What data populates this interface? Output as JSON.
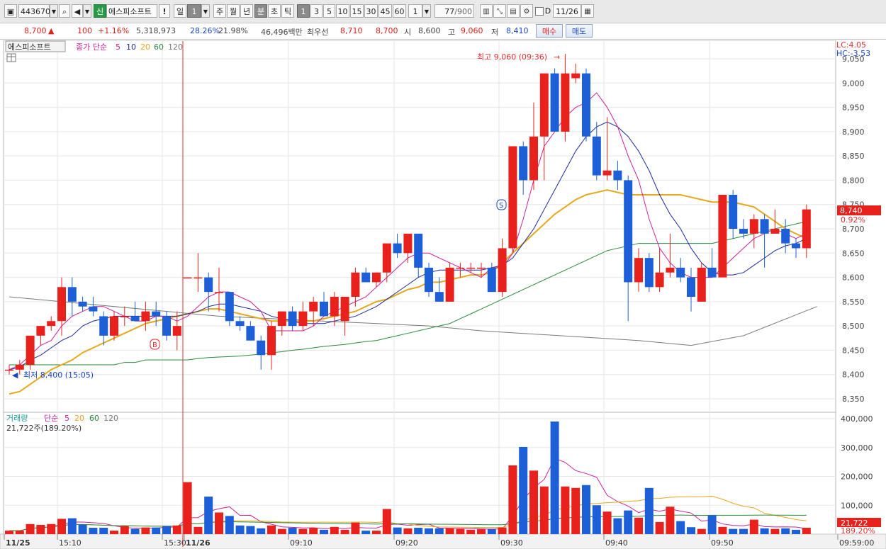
{
  "toolbar": {
    "code": "443670",
    "badge": "신",
    "name": "에스피소프트",
    "warn": "!",
    "period_day": "일",
    "period_num": "1",
    "p_week": "주",
    "p_month": "월",
    "p_year": "년",
    "p_min": "분",
    "p_sec": "초",
    "p_tick": "틱",
    "intervals": [
      "1",
      "3",
      "5",
      "10",
      "15",
      "30",
      "45",
      "60"
    ],
    "interval_value": "1",
    "count": "77",
    "count_total": "/900",
    "date_box_label": "D",
    "date": "11/26"
  },
  "quote": {
    "price": "8,700",
    "arrow": "▲",
    "change": "100",
    "change_pct": "+1.16%",
    "volume": "5,318,973",
    "vol_ratio": "28.26%",
    "turnover": "21.98%",
    "amount": "46,496백만",
    "best_label": "최우선",
    "ask": "8,710",
    "bid": "8,700",
    "open_label": "시",
    "open": "8,600",
    "high_label": "고",
    "high": "9,060",
    "low_label": "저",
    "low": "8,410",
    "buy": "매수",
    "sell": "매도"
  },
  "legend": {
    "name": "에스피소프트",
    "series": "종가 단순",
    "ma5": "5",
    "ma10": "10",
    "ma20": "20",
    "ma60": "60",
    "ma120": "120"
  },
  "annotations": {
    "high": "최고 9,060 (09:36)",
    "low": "최저 8,400 (15:05)",
    "lc": "LC:4.05",
    "hc": "HC:-3.53",
    "last_price": "8,740",
    "last_pct": "0.92%",
    "buy_mark": "B",
    "sell_mark": "S"
  },
  "volume_legend": {
    "name": "거래량",
    "series": "단순",
    "ma5": "5",
    "ma20": "20",
    "ma60": "60",
    "ma120": "120",
    "current": "21,722주(189.20%)",
    "last_value": "21,722",
    "last_pct": "189.20%"
  },
  "colors": {
    "up": "#e8211c",
    "down": "#1d5fd6",
    "ma5": "#c8219c",
    "ma10": "#1b2a9a",
    "ma20": "#e5a81c",
    "ma60": "#2a8a3a",
    "ma120": "#7a7a7a"
  },
  "chart_data": {
    "type": "candlestick",
    "price_axis": {
      "min": 8350,
      "max": 9050,
      "ticks": [
        "9,050",
        "9,000",
        "8,950",
        "8,900",
        "8,850",
        "8,800",
        "8,750",
        "8,700",
        "8,650",
        "8,600",
        "8,550",
        "8,500",
        "8,450",
        "8,400",
        "8,350"
      ]
    },
    "volume_axis": {
      "min": 0,
      "max": 400000,
      "ticks": [
        "400,000",
        "300,000",
        "200,000",
        "100,000"
      ]
    },
    "x_labels": [
      "11/25",
      "15:10",
      "15:30",
      "11/26",
      "09:10",
      "09:20",
      "09:30",
      "09:40",
      "09:50",
      "09:59:00"
    ],
    "candles": [
      [
        8410,
        8420,
        8400,
        8410
      ],
      [
        8410,
        8430,
        8400,
        8420
      ],
      [
        8420,
        8480,
        8410,
        8480
      ],
      [
        8480,
        8500,
        8460,
        8500
      ],
      [
        8500,
        8520,
        8490,
        8510
      ],
      [
        8510,
        8600,
        8480,
        8580
      ],
      [
        8580,
        8600,
        8520,
        8550
      ],
      [
        8550,
        8560,
        8530,
        8540
      ],
      [
        8540,
        8560,
        8520,
        8530
      ],
      [
        8520,
        8530,
        8460,
        8480
      ],
      [
        8480,
        8530,
        8470,
        8520
      ],
      [
        8520,
        8540,
        8500,
        8520
      ],
      [
        8520,
        8550,
        8510,
        8510
      ],
      [
        8510,
        8550,
        8490,
        8530
      ],
      [
        8530,
        8550,
        8500,
        8520
      ],
      [
        8520,
        8530,
        8470,
        8480
      ],
      [
        8480,
        8530,
        8450,
        8500
      ],
      [
        8600,
        8600,
        8600,
        8600
      ],
      [
        8600,
        8650,
        8570,
        8600
      ],
      [
        8600,
        8610,
        8530,
        8570
      ],
      [
        8570,
        8620,
        8530,
        8570
      ],
      [
        8570,
        8570,
        8500,
        8510
      ],
      [
        8510,
        8520,
        8490,
        8500
      ],
      [
        8500,
        8510,
        8470,
        8470
      ],
      [
        8470,
        8480,
        8410,
        8440
      ],
      [
        8440,
        8510,
        8410,
        8500
      ],
      [
        8500,
        8530,
        8480,
        8530
      ],
      [
        8530,
        8540,
        8490,
        8500
      ],
      [
        8500,
        8550,
        8490,
        8530
      ],
      [
        8530,
        8560,
        8500,
        8550
      ],
      [
        8550,
        8570,
        8520,
        8520
      ],
      [
        8520,
        8570,
        8500,
        8560
      ],
      [
        8510,
        8560,
        8480,
        8560
      ],
      [
        8560,
        8620,
        8540,
        8610
      ],
      [
        8610,
        8620,
        8590,
        8590
      ],
      [
        8590,
        8610,
        8580,
        8610
      ],
      [
        8610,
        8650,
        8590,
        8670
      ],
      [
        8670,
        8690,
        8640,
        8650
      ],
      [
        8650,
        8690,
        8630,
        8690
      ],
      [
        8690,
        8690,
        8600,
        8620
      ],
      [
        8620,
        8630,
        8560,
        8570
      ],
      [
        8570,
        8600,
        8550,
        8550
      ],
      [
        8550,
        8630,
        8550,
        8620
      ],
      [
        8620,
        8630,
        8600,
        8620
      ],
      [
        8620,
        8630,
        8610,
        8620
      ],
      [
        8620,
        8630,
        8600,
        8620
      ],
      [
        8620,
        8630,
        8570,
        8570
      ],
      [
        8570,
        8680,
        8560,
        8660
      ],
      [
        8660,
        8870,
        8650,
        8870
      ],
      [
        8870,
        8880,
        8770,
        8800
      ],
      [
        8800,
        8960,
        8780,
        8890
      ],
      [
        8890,
        8960,
        8800,
        9020
      ],
      [
        9020,
        9030,
        8900,
        8900
      ],
      [
        8900,
        9060,
        8880,
        9020
      ],
      [
        9010,
        9040,
        9000,
        9020
      ],
      [
        9020,
        9030,
        8880,
        8890
      ],
      [
        8890,
        8920,
        8800,
        8810
      ],
      [
        8810,
        8930,
        8800,
        8820
      ],
      [
        8820,
        8840,
        8780,
        8800
      ],
      [
        8800,
        8810,
        8510,
        8590
      ],
      [
        8590,
        8660,
        8570,
        8640
      ],
      [
        8640,
        8650,
        8570,
        8580
      ],
      [
        8580,
        8660,
        8570,
        8610
      ],
      [
        8610,
        8690,
        8600,
        8620
      ],
      [
        8620,
        8640,
        8590,
        8600
      ],
      [
        8600,
        8620,
        8530,
        8560
      ],
      [
        8550,
        8630,
        8550,
        8620
      ],
      [
        8620,
        8660,
        8600,
        8600
      ],
      [
        8600,
        8770,
        8600,
        8770
      ],
      [
        8770,
        8780,
        8680,
        8700
      ],
      [
        8700,
        8720,
        8680,
        8690
      ],
      [
        8690,
        8730,
        8660,
        8720
      ],
      [
        8720,
        8730,
        8620,
        8690
      ],
      [
        8690,
        8740,
        8690,
        8700
      ],
      [
        8700,
        8720,
        8650,
        8670
      ],
      [
        8670,
        8680,
        8640,
        8660
      ],
      [
        8660,
        8750,
        8640,
        8740
      ]
    ],
    "volumes": [
      12000,
      12000,
      35000,
      32000,
      35000,
      53000,
      55000,
      33000,
      22000,
      22000,
      12000,
      28000,
      18000,
      23000,
      23000,
      28000,
      30000,
      180000,
      25000,
      130000,
      75000,
      63000,
      30000,
      28000,
      20000,
      30000,
      18000,
      22000,
      18000,
      22000,
      15000,
      25000,
      15000,
      40000,
      12000,
      12000,
      87000,
      23000,
      20000,
      22000,
      20000,
      20000,
      20000,
      18000,
      15000,
      17000,
      17000,
      23000,
      238000,
      302000,
      220000,
      165000,
      390000,
      165000,
      160000,
      170000,
      100000,
      78000,
      55000,
      82000,
      57000,
      160000,
      42000,
      95000,
      45000,
      24000,
      18000,
      65000,
      25000,
      18000,
      18000,
      50000,
      20000,
      18000,
      20000,
      15000,
      22000
    ],
    "ma": {
      "ma5": [
        8410,
        8420,
        8440,
        8460,
        8470,
        8500,
        8520,
        8530,
        8540,
        8540,
        8530,
        8520,
        8510,
        8510,
        8520,
        8520,
        8510,
        8520,
        8540,
        8560,
        8570,
        8570,
        8560,
        8550,
        8530,
        8490,
        8490,
        8490,
        8490,
        8500,
        8520,
        8530,
        8540,
        8550,
        8560,
        8580,
        8600,
        8620,
        8640,
        8650,
        8650,
        8640,
        8630,
        8620,
        8610,
        8600,
        8620,
        8620,
        8650,
        8720,
        8800,
        8870,
        8900,
        8930,
        8950,
        8960,
        8980,
        8950,
        8910,
        8850,
        8800,
        8720,
        8660,
        8630,
        8610,
        8600,
        8600,
        8600,
        8620,
        8640,
        8660,
        8680,
        8690,
        8700,
        8690,
        8680,
        8690
      ],
      "ma10": [
        8410,
        8415,
        8430,
        8440,
        8455,
        8470,
        8480,
        8500,
        8510,
        8515,
        8520,
        8520,
        8520,
        8520,
        8520,
        8520,
        8520,
        8525,
        8530,
        8540,
        8545,
        8545,
        8540,
        8535,
        8530,
        8520,
        8515,
        8510,
        8505,
        8505,
        8505,
        8510,
        8515,
        8520,
        8530,
        8540,
        8555,
        8570,
        8585,
        8600,
        8610,
        8615,
        8615,
        8615,
        8615,
        8615,
        8620,
        8625,
        8640,
        8670,
        8700,
        8740,
        8780,
        8820,
        8860,
        8890,
        8910,
        8920,
        8910,
        8890,
        8860,
        8820,
        8770,
        8730,
        8700,
        8660,
        8630,
        8610,
        8605,
        8605,
        8610,
        8625,
        8640,
        8655,
        8665,
        8670,
        8680
      ],
      "ma20": [
        8360,
        8365,
        8380,
        8395,
        8410,
        8420,
        8430,
        8445,
        8455,
        8465,
        8475,
        8485,
        8495,
        8505,
        8510,
        8515,
        8520,
        8525,
        8530,
        8535,
        8535,
        8530,
        8525,
        8520,
        8515,
        8510,
        8510,
        8510,
        8510,
        8510,
        8515,
        8520,
        8525,
        8530,
        8540,
        8550,
        8555,
        8565,
        8575,
        8580,
        8590,
        8590,
        8595,
        8600,
        8605,
        8605,
        8610,
        8630,
        8650,
        8670,
        8690,
        8710,
        8730,
        8745,
        8760,
        8770,
        8775,
        8780,
        8775,
        8770,
        8770,
        8770,
        8770,
        8770,
        8770,
        8765,
        8760,
        8755,
        8755,
        8755,
        8750,
        8745,
        8730,
        8715,
        8700,
        8690,
        8680
      ],
      "ma60": [
        8420,
        8420,
        8420,
        8420,
        8420,
        8420,
        8420,
        8420,
        8420,
        8420,
        8420,
        8425,
        8425,
        8430,
        8430,
        8430,
        8430,
        8430,
        8433,
        8435,
        8436,
        8437,
        8438,
        8440,
        8442,
        8445,
        8447,
        8450,
        8452,
        8455,
        8458,
        8460,
        8462,
        8465,
        8468,
        8470,
        8475,
        8480,
        8485,
        8490,
        8495,
        8500,
        8505,
        8515,
        8525,
        8535,
        8545,
        8555,
        8565,
        8575,
        8585,
        8595,
        8605,
        8615,
        8625,
        8635,
        8645,
        8655,
        8660,
        8665,
        8670,
        8670,
        8670,
        8670,
        8670,
        8670,
        8670,
        8670,
        8675,
        8680,
        8685,
        8690,
        8695,
        8700,
        8705,
        8710,
        8715
      ]
    },
    "ma120": [
      [
        0,
        8560
      ],
      [
        20,
        8520
      ],
      [
        40,
        8500
      ],
      [
        45,
        8490
      ],
      [
        60,
        8470
      ],
      [
        65,
        8460
      ],
      [
        70,
        8480
      ],
      [
        77,
        8540
      ]
    ]
  }
}
